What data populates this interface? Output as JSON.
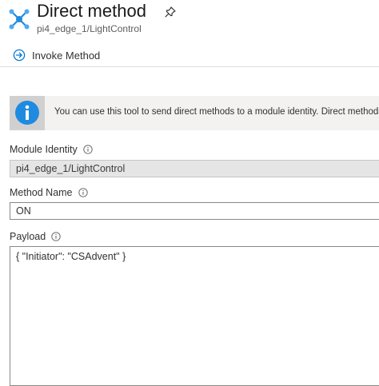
{
  "header": {
    "title": "Direct method",
    "subtitle": "pi4_edge_1/LightControl",
    "icon": "iot-hub-icon",
    "pin_icon": "pin-icon"
  },
  "toolbar": {
    "invoke_label": "Invoke Method",
    "invoke_icon": "arrow-circle-right-icon"
  },
  "info": {
    "text": "You can use this tool to send direct methods to a module identity. Direct methods hav",
    "icon": "info-icon"
  },
  "form": {
    "module_identity": {
      "label": "Module Identity",
      "value": "pi4_edge_1/LightControl"
    },
    "method_name": {
      "label": "Method Name",
      "value": "ON"
    },
    "payload": {
      "label": "Payload",
      "value": "{ \"Initiator\": \"CSAdvent\" }"
    }
  },
  "colors": {
    "accent": "#0078d4",
    "icon_blue": "#1f8be0",
    "border": "#8a8886",
    "disabled_bg": "#e5e5e5",
    "banner_bg": "#f3f2f1"
  }
}
